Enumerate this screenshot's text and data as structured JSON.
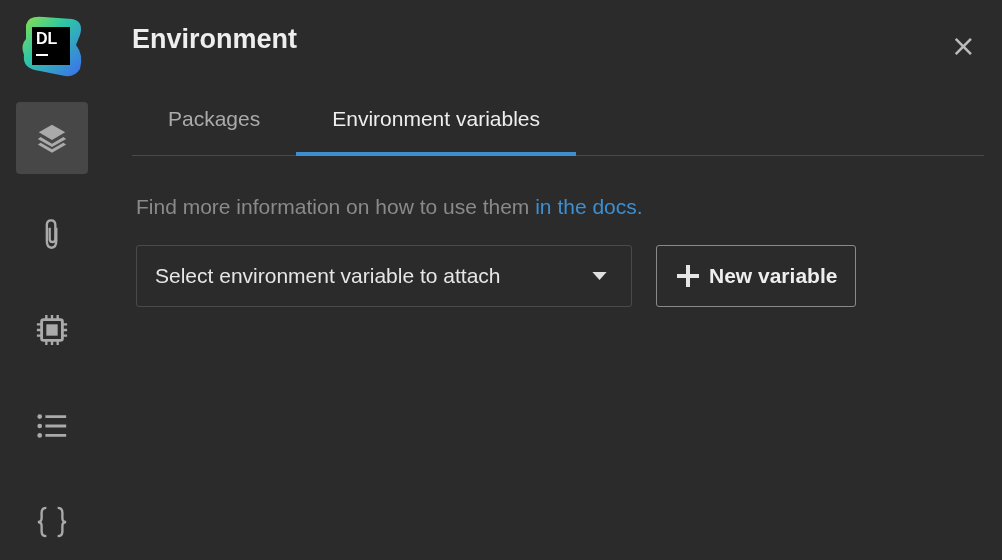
{
  "logo": {
    "text": "DL"
  },
  "sidebar": {
    "items": [
      {
        "kind": "layers",
        "selected": true
      },
      {
        "kind": "paperclip",
        "selected": false
      },
      {
        "kind": "chip",
        "selected": false
      },
      {
        "kind": "list",
        "selected": false
      },
      {
        "kind": "braces",
        "selected": false
      }
    ]
  },
  "header": {
    "title": "Environment",
    "close": "×"
  },
  "tabs": [
    {
      "label": "Packages",
      "selected": false
    },
    {
      "label": "Environment variables",
      "selected": true
    }
  ],
  "info": {
    "text": "Find more information on how to use them ",
    "link": "in the docs."
  },
  "dropdown": {
    "placeholder": "Select environment variable to attach"
  },
  "new_button": {
    "label": "New variable"
  }
}
